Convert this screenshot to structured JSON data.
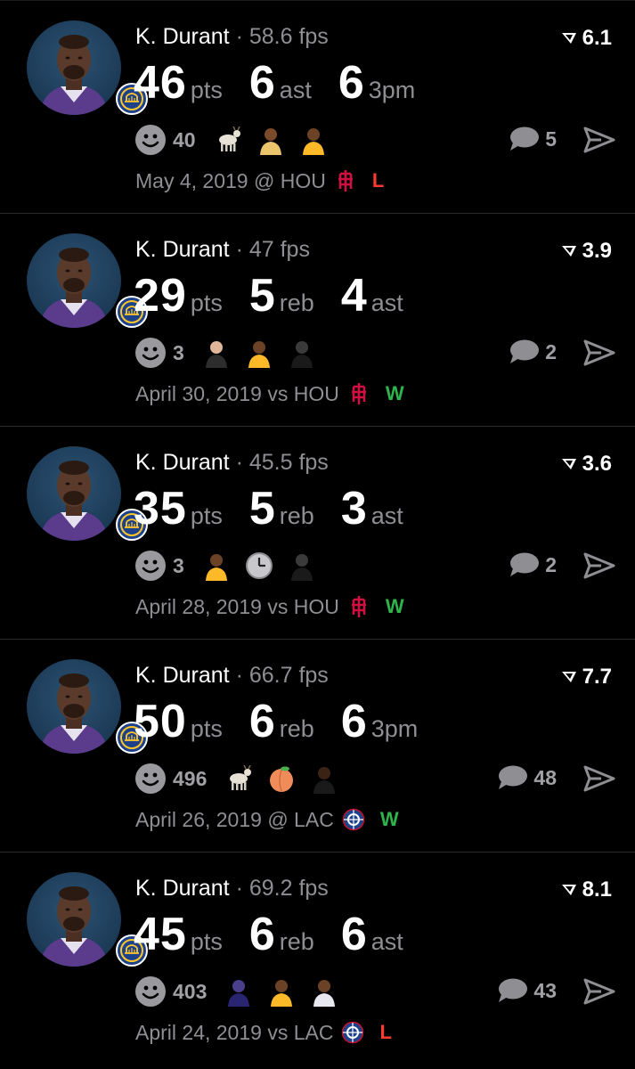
{
  "accent": {
    "win": "#2db54b",
    "loss": "#ff3b30",
    "muted": "#8e8e93"
  },
  "feed": [
    {
      "player": "K. Durant",
      "separator": "·",
      "fps": "58.6 fps",
      "rating": "6.1",
      "stats": [
        {
          "num": "46",
          "label": "pts"
        },
        {
          "num": "6",
          "label": "ast"
        },
        {
          "num": "6",
          "label": "3pm"
        }
      ],
      "reactions": "40",
      "emojis": [
        "goat-emoji",
        "player-shrug-emoji",
        "player-lakers-emoji"
      ],
      "comments": "5",
      "date_line": "May 4, 2019 @ HOU",
      "opponent": "rockets-logo",
      "result": "L",
      "result_color": "#ff3b30"
    },
    {
      "player": "K. Durant",
      "separator": "·",
      "fps": "47 fps",
      "rating": "3.9",
      "stats": [
        {
          "num": "29",
          "label": "pts"
        },
        {
          "num": "5",
          "label": "reb"
        },
        {
          "num": "4",
          "label": "ast"
        }
      ],
      "reactions": "3",
      "emojis": [
        "screaming-player-emoji",
        "player-lakers-emoji",
        "standing-figure-emoji"
      ],
      "comments": "2",
      "date_line": "April 30, 2019 vs HOU",
      "opponent": "rockets-logo",
      "result": "W",
      "result_color": "#2db54b"
    },
    {
      "player": "K. Durant",
      "separator": "·",
      "fps": "45.5 fps",
      "rating": "3.6",
      "stats": [
        {
          "num": "35",
          "label": "pts"
        },
        {
          "num": "5",
          "label": "reb"
        },
        {
          "num": "3",
          "label": "ast"
        }
      ],
      "reactions": "3",
      "emojis": [
        "player-lakers-emoji",
        "clock-emoji",
        "standing-figure-emoji"
      ],
      "comments": "2",
      "date_line": "April 28, 2019 vs HOU",
      "opponent": "rockets-logo",
      "result": "W",
      "result_color": "#2db54b"
    },
    {
      "player": "K. Durant",
      "separator": "·",
      "fps": "66.7 fps",
      "rating": "7.7",
      "stats": [
        {
          "num": "50",
          "label": "pts"
        },
        {
          "num": "6",
          "label": "reb"
        },
        {
          "num": "6",
          "label": "3pm"
        }
      ],
      "reactions": "496",
      "emojis": [
        "goat-emoji",
        "peach-emoji",
        "player-face-emoji"
      ],
      "comments": "48",
      "date_line": "April 26, 2019 @ LAC",
      "opponent": "clippers-logo",
      "result": "W",
      "result_color": "#2db54b"
    },
    {
      "player": "K. Durant",
      "separator": "·",
      "fps": "69.2 fps",
      "rating": "8.1",
      "stats": [
        {
          "num": "45",
          "label": "pts"
        },
        {
          "num": "6",
          "label": "reb"
        },
        {
          "num": "6",
          "label": "ast"
        }
      ],
      "reactions": "403",
      "emojis": [
        "purple-player-emoji",
        "player-lakers-emoji",
        "player-lakers-jersey-emoji"
      ],
      "comments": "43",
      "date_line": "April 24, 2019 vs LAC",
      "opponent": "clippers-logo",
      "result": "L",
      "result_color": "#ff3b30"
    }
  ]
}
